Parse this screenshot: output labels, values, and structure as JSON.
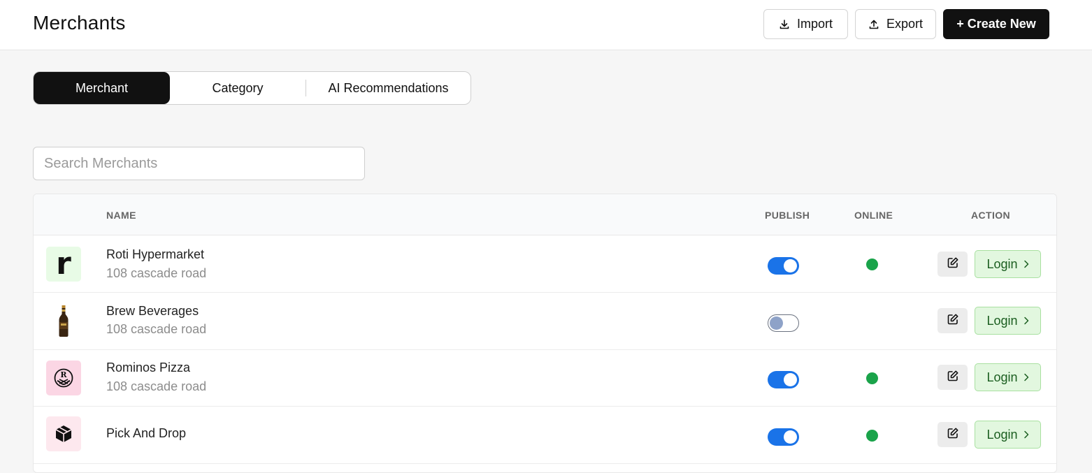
{
  "header": {
    "title": "Merchants",
    "import_label": "Import",
    "export_label": "Export",
    "create_label": "+ Create New"
  },
  "tabs": [
    {
      "label": "Merchant",
      "active": true
    },
    {
      "label": "Category",
      "active": false
    },
    {
      "label": "AI Recommendations",
      "active": false
    }
  ],
  "search": {
    "placeholder": "Search Merchants",
    "value": ""
  },
  "table": {
    "columns": [
      "NAME",
      "PUBLISH",
      "ONLINE",
      "ACTION"
    ],
    "rows": [
      {
        "name": "Roti Hypermarket",
        "address": "108 cascade road",
        "logo": "letter-r-logo",
        "published": true,
        "online": true,
        "login_label": "Login"
      },
      {
        "name": "Brew Beverages",
        "address": "108 cascade road",
        "logo": "beer-bottle-logo",
        "published": false,
        "online": false,
        "login_label": "Login"
      },
      {
        "name": "Rominos Pizza",
        "address": "108 cascade road",
        "logo": "pizza-badge-logo",
        "published": true,
        "online": true,
        "login_label": "Login"
      },
      {
        "name": "Pick And Drop",
        "address": "",
        "logo": "package-box-logo",
        "published": true,
        "online": true,
        "login_label": "Login"
      }
    ]
  },
  "colors": {
    "primary_dark": "#111111",
    "toggle_on": "#1a73e8",
    "online_green": "#1aa34a",
    "login_bg": "#e2f7df",
    "login_text": "#1b5e20"
  }
}
